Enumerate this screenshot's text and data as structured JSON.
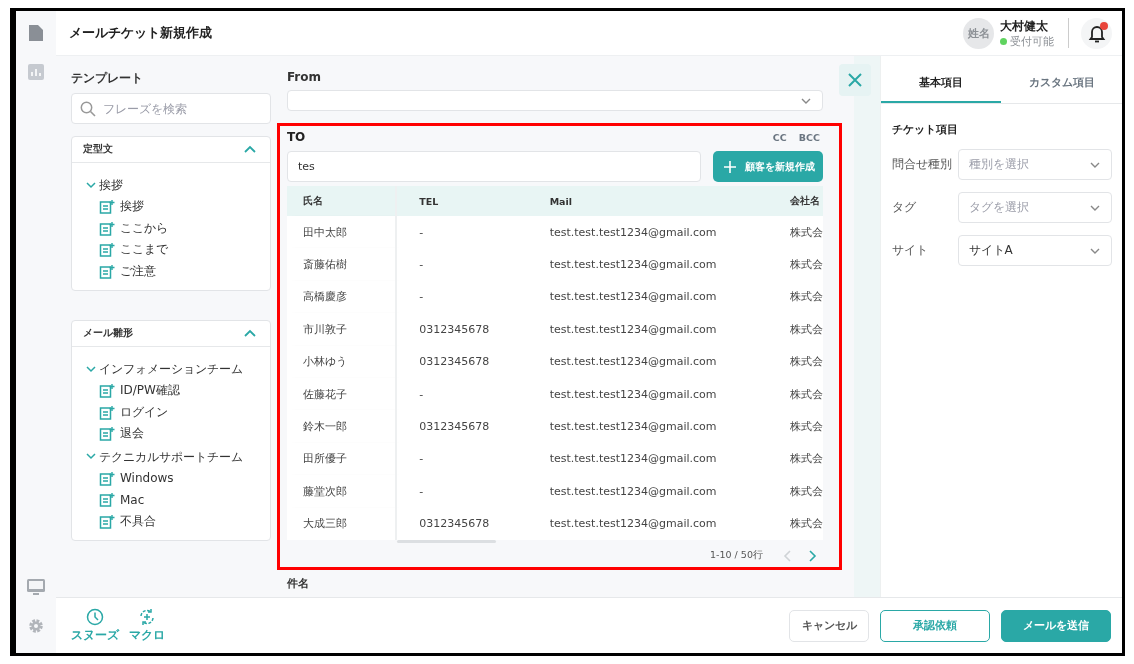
{
  "header": {
    "title": "メールチケット新規作成",
    "user": {
      "avatar": "姓名",
      "name": "大村健太",
      "status": "受付可能"
    },
    "notifications": {
      "unread": true
    }
  },
  "template": {
    "title": "テンプレート",
    "search": {
      "placeholder": "フレーズを検索"
    },
    "sections": [
      {
        "title": "定型文",
        "expanded": true,
        "items": [
          {
            "label": "挨拶",
            "expanded": true,
            "children": [
              {
                "label": "挨拶"
              },
              {
                "label": "ここから"
              },
              {
                "label": "ここまで"
              },
              {
                "label": "ご注意"
              }
            ]
          }
        ]
      },
      {
        "title": "メール雛形",
        "expanded": true,
        "items": [
          {
            "label": "インフォメーションチーム",
            "expanded": true,
            "children": [
              {
                "label": "ID/PW確認"
              },
              {
                "label": "ログイン"
              },
              {
                "label": "退会"
              }
            ]
          },
          {
            "label": "テクニカルサポートチーム",
            "expanded": true,
            "children": [
              {
                "label": "Windows"
              },
              {
                "label": "Mac"
              },
              {
                "label": "不具合"
              }
            ]
          }
        ]
      }
    ]
  },
  "compose": {
    "from": {
      "label": "From"
    },
    "to": {
      "label": "TO",
      "links": [
        "CC",
        "BCC"
      ],
      "search": {
        "value": "tes"
      },
      "new_button": {
        "label": "顧客を新規作成"
      },
      "table": {
        "columns": [
          "氏名",
          "TEL",
          "Mail",
          "会社名"
        ],
        "rows": [
          [
            "田中太郎",
            "-",
            "test.test.test1234@gmail.com",
            "株式会"
          ],
          [
            "斎藤佑樹",
            "-",
            "test.test.test1234@gmail.com",
            "株式会"
          ],
          [
            "高橋慶彦",
            "-",
            "test.test.test1234@gmail.com",
            "株式会"
          ],
          [
            "市川敦子",
            "0312345678",
            "test.test.test1234@gmail.com",
            "株式会"
          ],
          [
            "小林ゆう",
            "0312345678",
            "test.test.test1234@gmail.com",
            "株式会"
          ],
          [
            "佐藤花子",
            "-",
            "test.test.test1234@gmail.com",
            "株式会"
          ],
          [
            "鈴木一郎",
            "0312345678",
            "test.test.test1234@gmail.com",
            "株式会"
          ],
          [
            "田所優子",
            "-",
            "test.test.test1234@gmail.com",
            "株式会"
          ],
          [
            "藤堂次郎",
            "-",
            "test.test.test1234@gmail.com",
            "株式会"
          ],
          [
            "大成三郎",
            "0312345678",
            "test.test.test1234@gmail.com",
            "株式会"
          ]
        ]
      },
      "pagination": {
        "text": "1-10 / 50行",
        "prev_disabled": true,
        "next_disabled": false
      }
    },
    "subject": {
      "label": "件名"
    }
  },
  "side_panel": {
    "tabs": [
      {
        "label": "基本項目",
        "selected": true
      },
      {
        "label": "カスタム項目",
        "selected": false
      }
    ],
    "section_title": "チケット項目",
    "fields": [
      {
        "label": "問合せ種別",
        "placeholder": "種別を選択"
      },
      {
        "label": "タグ",
        "placeholder": "タグを選択"
      },
      {
        "label": "サイト",
        "value": "サイトA"
      }
    ]
  },
  "footer": {
    "tools": [
      {
        "kind": "clock",
        "label": "スヌーズ"
      },
      {
        "kind": "macro",
        "label": "マクロ"
      }
    ],
    "buttons": [
      {
        "kind": "secondary",
        "label": "キャンセル"
      },
      {
        "kind": "outline",
        "label": "承認依頼"
      },
      {
        "kind": "primary",
        "label": "メールを送信"
      }
    ]
  }
}
